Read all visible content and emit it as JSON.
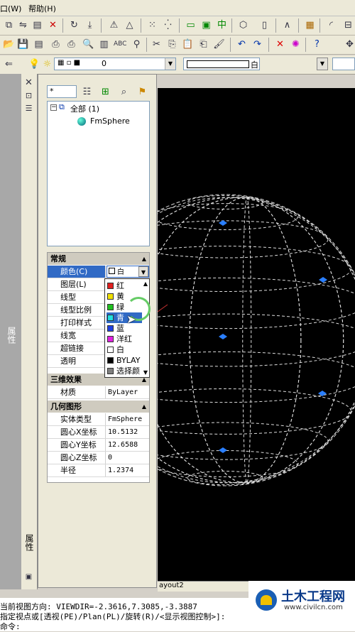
{
  "menubar": {
    "item1": "口(W)",
    "help": "帮助(H)"
  },
  "layer_bar": {
    "layer_value": "0",
    "color_value": "白"
  },
  "side_labels": {
    "properties": "属性",
    "properties_bottom": "属性"
  },
  "panel": {
    "filter_value": "*",
    "tree": {
      "root": "全部 (1)",
      "child": "FmSphere"
    },
    "sections": {
      "general": "常规",
      "three_d": "三维效果",
      "geometry": "几何图形"
    },
    "general_rows": [
      {
        "label": "颜色(C)",
        "value": "白"
      },
      {
        "label": "图层(L)",
        "value": ""
      },
      {
        "label": "线型",
        "value": ""
      },
      {
        "label": "线型比例",
        "value": ""
      },
      {
        "label": "打印样式",
        "value": ""
      },
      {
        "label": "线宽",
        "value": ""
      },
      {
        "label": "超链接",
        "value": ""
      },
      {
        "label": "透明",
        "value": ""
      }
    ],
    "three_d_rows": [
      {
        "label": "材质",
        "value": "ByLayer"
      }
    ],
    "geometry_rows": [
      {
        "label": "实体类型",
        "value": "FmSphere"
      },
      {
        "label": "圆心X坐标",
        "value": "10.5132"
      },
      {
        "label": "圆心Y坐标",
        "value": "12.6588"
      },
      {
        "label": "圆心Z坐标",
        "value": "0"
      },
      {
        "label": "半径",
        "value": "1.2374"
      }
    ]
  },
  "color_dropdown": {
    "items": [
      {
        "label": "红",
        "color": "#e02020"
      },
      {
        "label": "黄",
        "color": "#f0e000"
      },
      {
        "label": "绿",
        "color": "#20c020"
      },
      {
        "label": "青",
        "color": "#20e0e0"
      },
      {
        "label": "蓝",
        "color": "#2040e0"
      },
      {
        "label": "洋红",
        "color": "#e020e0"
      },
      {
        "label": "白",
        "color": "#ffffff"
      },
      {
        "label": "BYLAY",
        "color": "#000000"
      },
      {
        "label": "选择颜",
        "color": "#808080"
      }
    ]
  },
  "layout_tab": "ayout2",
  "command_lines": {
    "line1": "当前视图方向:  VIEWDIR=-2.3616,7.3085,-3.3887",
    "line2": "指定视点或[透视(PE)/Plan(PL)/旋转(R)/<显示视图控制>]:",
    "line3": "命令:"
  },
  "watermark": {
    "title": "土木工程网",
    "url": "www.civilcn.com"
  }
}
